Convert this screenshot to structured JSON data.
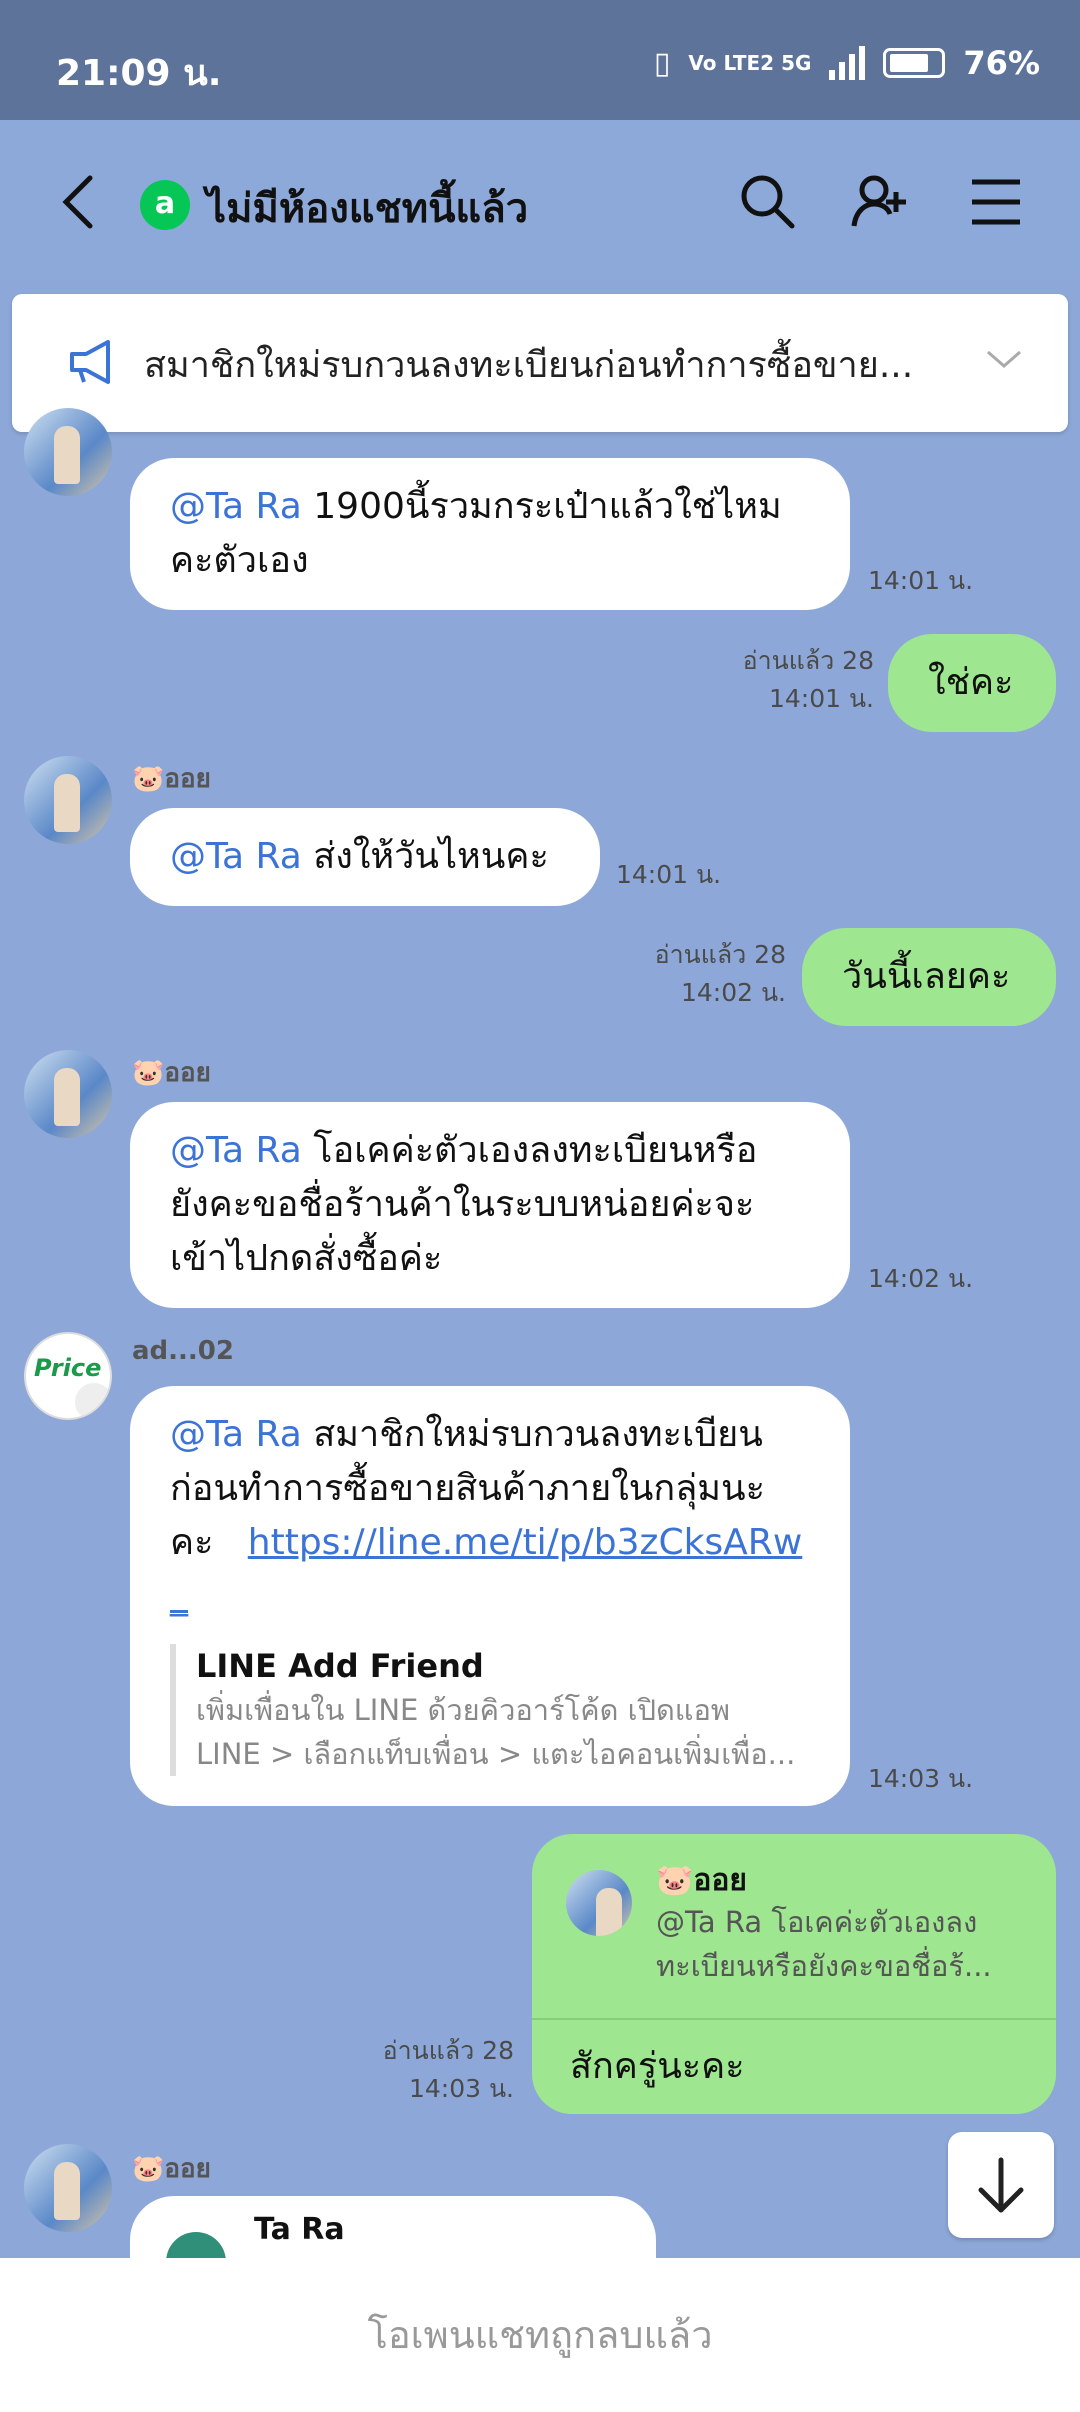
{
  "status": {
    "time": "21:09 น.",
    "network": "Vo LTE2 5G",
    "battery": "76%"
  },
  "header": {
    "room_icon": "a",
    "title": "ไม่มีห้องแชทนี้แล้ว"
  },
  "announcement": {
    "text": "สมาชิกใหม่รบกวนลงทะเบียนก่อนทำการซื้อขาย..."
  },
  "messages": [
    {
      "mention": "@Ta Ra",
      "line1": " 1900นี้รวมกระเป๋าแล้วใช่ไหม",
      "line2": "คะตัวเอง",
      "time": "14:01 น."
    },
    {
      "text": "ใช่คะ",
      "read": "อ่านแล้ว 28",
      "time": "14:01 น."
    },
    {
      "sender": "🐷ออย",
      "mention": "@Ta Ra",
      "text": " ส่งให้วันไหนคะ",
      "time": "14:01 น."
    },
    {
      "text": "วันนี้เลยคะ",
      "read": "อ่านแล้ว 28",
      "time": "14:02 น."
    },
    {
      "sender": "🐷ออย",
      "mention": "@Ta Ra",
      "line1": " โอเคค่ะตัวเองลงทะเบียนหรือ",
      "line2": "ยังคะขอชื่อร้านค้าในระบบหน่อยค่ะจะ",
      "line3": "เข้าไปกดสั่งซื้อค่ะ",
      "time": "14:02 น."
    },
    {
      "sender": "ad...02",
      "avatar_text": "Price",
      "mention": "@Ta Ra",
      "line1": " สมาชิกใหม่รบกวนลงทะเบียน",
      "line2": "ก่อนทำการซื้อขายสินค้าภายในกลุ่มนะ",
      "line3": "คะ",
      "link": "https://line.me/ti/p/b3zCksARw",
      "link_tail": "_",
      "preview_title": "LINE Add Friend",
      "preview_desc1": "เพิ่มเพื่อนใน LINE ด้วยคิวอาร์โค้ด เปิดแอพ",
      "preview_desc2": "LINE > เลือกแท็บเพื่อน > แตะไอคอนเพิ่มเพื่อ...",
      "time": "14:03 น."
    },
    {
      "reply_sender": "🐷ออย",
      "reply_line1": "@Ta Ra โอเคค่ะตัวเองลง",
      "reply_line2": "ทะเบียนหรือยังคะขอชื่อร้...",
      "text": "สักครู่นะคะ",
      "read": "อ่านแล้ว 28",
      "time": "14:03 น."
    },
    {
      "sender": "🐷ออย",
      "reply_name": "Ta Ra"
    }
  ],
  "footer": {
    "text": "โอเพนแชทถูกลบแล้ว"
  }
}
